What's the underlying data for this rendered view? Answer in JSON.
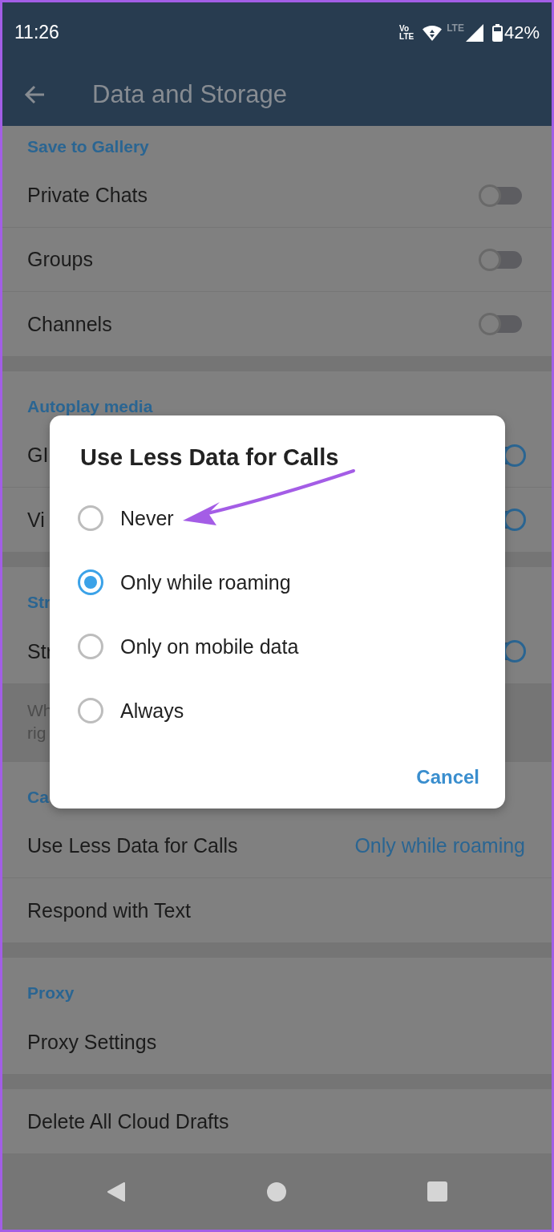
{
  "status_bar": {
    "time": "11:26",
    "volte": [
      "Vo",
      "LTE"
    ],
    "network": "LTE",
    "battery": "42%"
  },
  "header": {
    "title": "Data and Storage"
  },
  "sections": [
    {
      "title": "Save to Gallery",
      "rows": [
        {
          "kind": "toggle",
          "label": "Private Chats",
          "on": false
        },
        {
          "kind": "toggle",
          "label": "Groups",
          "on": false
        },
        {
          "kind": "toggle",
          "label": "Channels",
          "on": false
        }
      ]
    },
    {
      "title": "Autoplay media",
      "rows": [
        {
          "kind": "toggle",
          "label": "GI",
          "on": true
        },
        {
          "kind": "toggle",
          "label": "Vi",
          "on": true
        }
      ]
    },
    {
      "title": "Str",
      "rows": [
        {
          "kind": "toggle",
          "label": "Str",
          "on": true
        }
      ],
      "note": [
        "Wh",
        "rig"
      ]
    },
    {
      "title": "Ca",
      "rows": [
        {
          "kind": "value",
          "label": "Use Less Data for Calls",
          "value": "Only while roaming"
        },
        {
          "kind": "plain",
          "label": "Respond with Text"
        }
      ]
    },
    {
      "title": "Proxy",
      "rows": [
        {
          "kind": "plain",
          "label": "Proxy Settings"
        }
      ]
    },
    {
      "rows": [
        {
          "kind": "plain",
          "label": "Delete All Cloud Drafts"
        }
      ]
    }
  ],
  "dialog": {
    "title": "Use Less Data for Calls",
    "options": [
      {
        "label": "Never",
        "selected": false
      },
      {
        "label": "Only while roaming",
        "selected": true
      },
      {
        "label": "Only on mobile data",
        "selected": false
      },
      {
        "label": "Always",
        "selected": false
      }
    ],
    "buttons": [
      "Cancel"
    ]
  },
  "annotation": {
    "kind": "arrow"
  }
}
